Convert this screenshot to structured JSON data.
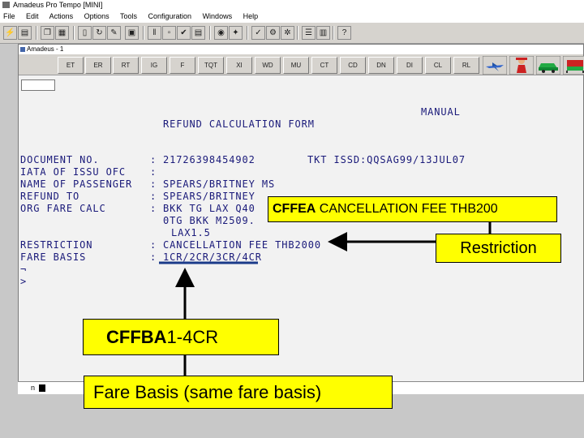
{
  "window": {
    "title": "Amadeus Pro Tempo [MINI]"
  },
  "menubar": {
    "items": [
      "File",
      "Edit",
      "Actions",
      "Options",
      "Tools",
      "Configuration",
      "Windows",
      "Help"
    ]
  },
  "inner_window": {
    "title": "Amadeus - 1",
    "command_buttons": [
      "ET",
      "ER",
      "RT",
      "IG",
      "F",
      "TQT",
      "XI",
      "WD",
      "MU",
      "CT",
      "CD",
      "DN",
      "DI",
      "CL",
      "RL"
    ]
  },
  "terminal": {
    "manual": "MANUAL",
    "form_title": "REFUND CALCULATION FORM",
    "rows": [
      {
        "label": "DOCUMENT NO.",
        "sep": ":",
        "value": "21726398454902",
        "extra": "TKT ISSD:QQSAG99/13JUL07"
      },
      {
        "label": "IATA OF ISSU OFC",
        "sep": ":",
        "value": ""
      },
      {
        "label": "NAME OF PASSENGER",
        "sep": ":",
        "value": "SPEARS/BRITNEY MS"
      },
      {
        "label": "REFUND TO",
        "sep": ":",
        "value": "SPEARS/BRITNEY"
      },
      {
        "label": "ORG FARE CALC",
        "sep": ":",
        "value": "BKK TG LAX Q40"
      },
      {
        "label": "",
        "sep": "",
        "value": "0TG BKK M2509."
      },
      {
        "label": "",
        "sep": "",
        "value": "LAX1.5"
      },
      {
        "label": "RESTRICTION",
        "sep": ":",
        "value": "CANCELLATION FEE THB2000"
      },
      {
        "label": "FARE BASIS",
        "sep": ":",
        "value": "1CR/2CR/3CR/4CR"
      },
      {
        "label": "¬",
        "sep": "",
        "value": ""
      },
      {
        "label": ">",
        "sep": "",
        "value": ""
      }
    ]
  },
  "statusbar": {
    "pane": "n"
  },
  "callouts": {
    "cancellation_fee": {
      "bold": "CFFEA",
      "rest": " CANCELLATION FEE THB200"
    },
    "restriction": "Restriction",
    "fare_basis_code": {
      "bold": "CFFBA",
      "rest": "1-4CR"
    },
    "fare_basis_note": "Fare Basis (same fare basis)"
  },
  "colors": {
    "callout_bg": "#ffff00",
    "terminal_text": "#1a1a7a",
    "underline": "#1a3a8a"
  }
}
